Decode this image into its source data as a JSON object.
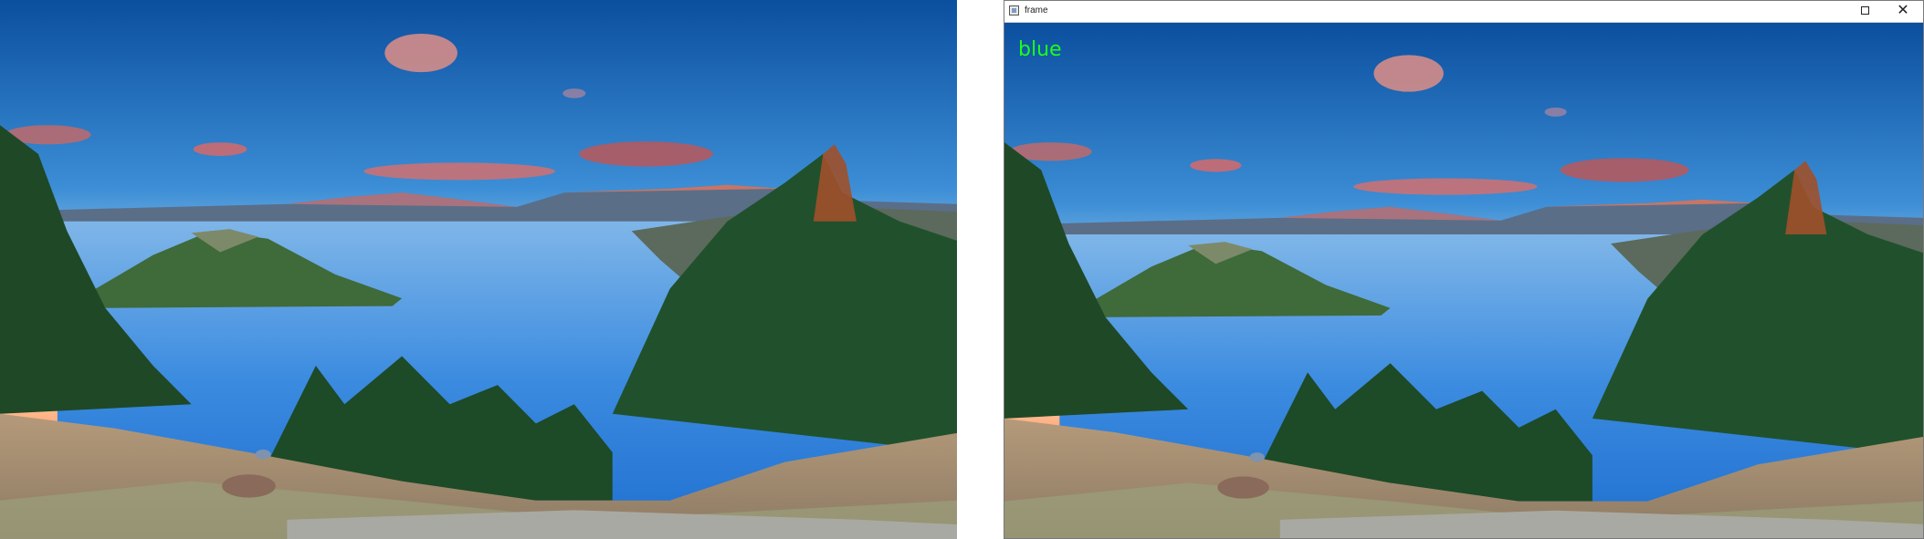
{
  "left_image": {
    "description_icon": "landscape-lake-photo"
  },
  "window": {
    "title": "frame",
    "close_label": "✕",
    "overlay_text": "blue",
    "overlay_color": "#1bff1b"
  },
  "colors": {
    "sky_top": "#0d5fb0",
    "sky_glow": "#ffd9a8",
    "lake": "#2f7fd8",
    "forest": "#1e4a2a"
  }
}
